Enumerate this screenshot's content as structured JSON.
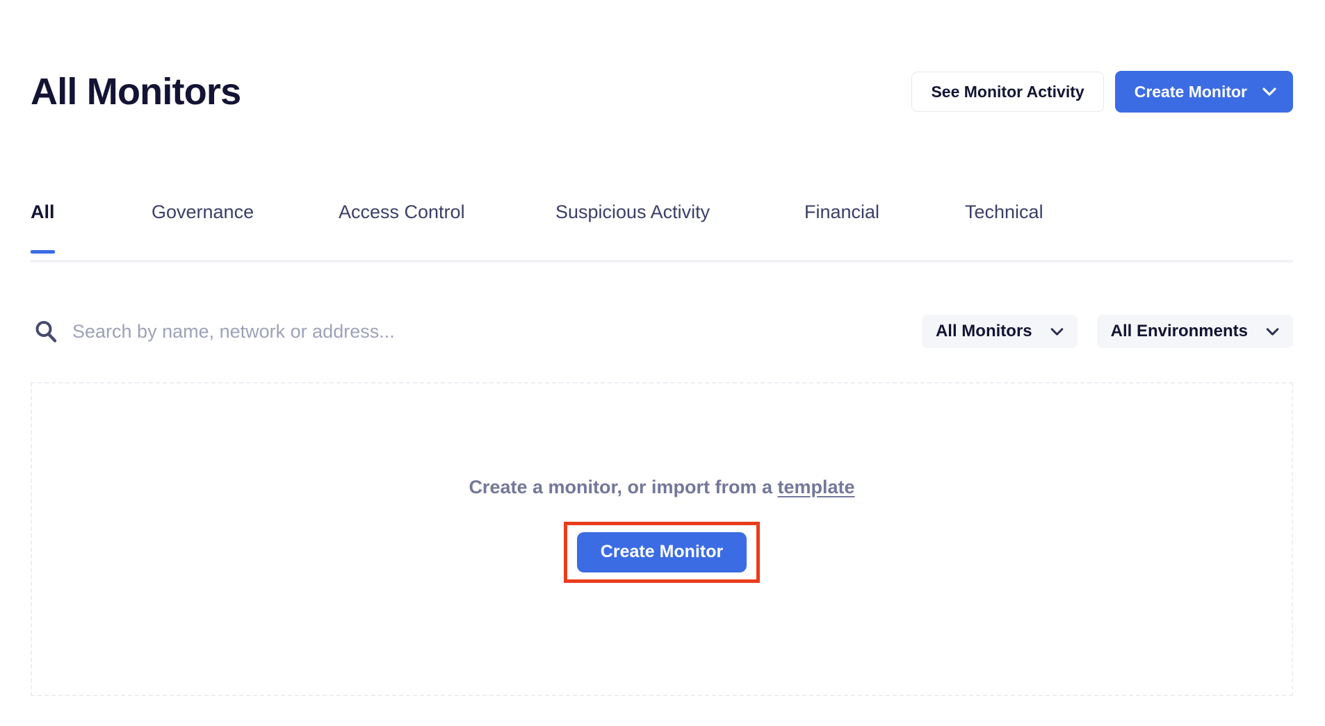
{
  "header": {
    "title": "All Monitors",
    "see_activity_label": "See Monitor Activity",
    "create_monitor_label": "Create Monitor",
    "chevron_icon": "chevron-down-icon"
  },
  "tabs": [
    {
      "label": "All",
      "active": true
    },
    {
      "label": "Governance",
      "active": false
    },
    {
      "label": "Access Control",
      "active": false
    },
    {
      "label": "Suspicious Activity",
      "active": false
    },
    {
      "label": "Financial",
      "active": false
    },
    {
      "label": "Technical",
      "active": false
    }
  ],
  "toolbar": {
    "search_icon": "search-icon",
    "search_value": "",
    "search_placeholder": "Search by name, network or address...",
    "monitor_filter": "All Monitors",
    "environment_filter": "All Environments"
  },
  "empty_state": {
    "message_prefix": "Create a monitor, or import from a ",
    "template_link": "template",
    "cta_label": "Create Monitor"
  },
  "colors": {
    "accent_blue": "#3b6ce4",
    "title_navy": "#131434",
    "muted_text": "#73779a",
    "placeholder": "#9ea2b8",
    "dashed_border": "#eceef3",
    "highlight_red": "#ea3c1d",
    "filter_bg": "#f5f6f9"
  }
}
